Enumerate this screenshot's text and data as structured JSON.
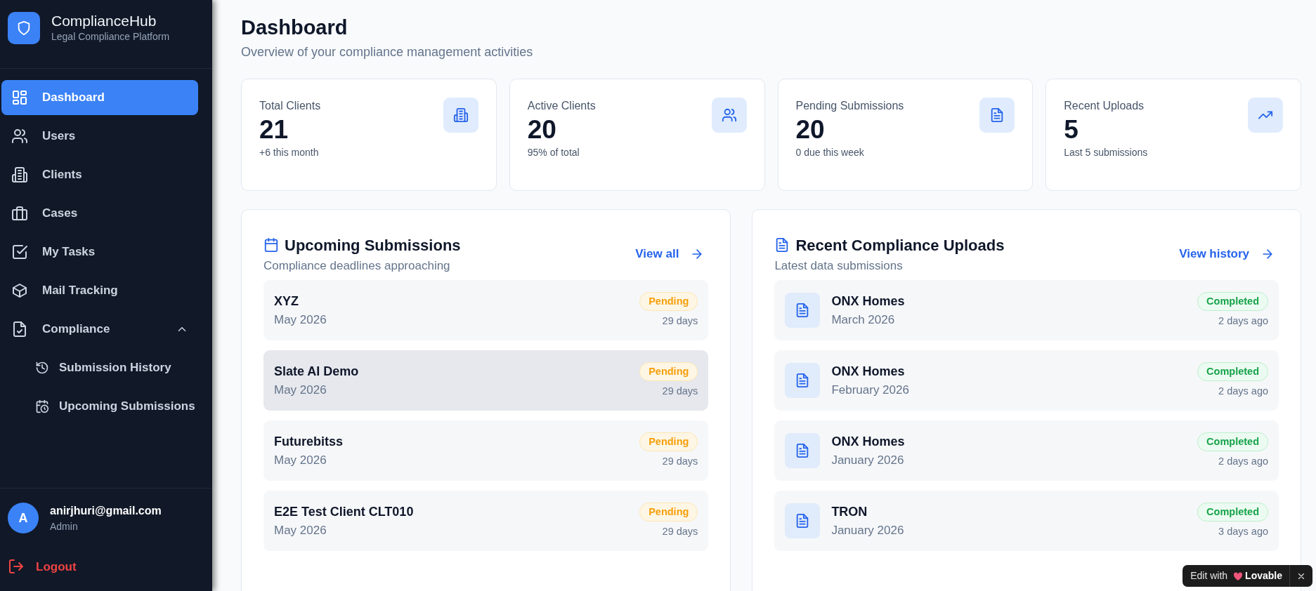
{
  "sidebar": {
    "brand": {
      "title": "ComplianceHub",
      "subtitle": "Legal Compliance Platform"
    },
    "nav": [
      {
        "label": "Dashboard",
        "selected": true
      },
      {
        "label": "Users",
        "selected": false
      },
      {
        "label": "Clients",
        "selected": false
      },
      {
        "label": "Cases",
        "selected": false
      },
      {
        "label": "My Tasks",
        "selected": false
      },
      {
        "label": "Mail Tracking",
        "selected": false
      },
      {
        "label": "Compliance",
        "selected": false,
        "expanded": true,
        "children": [
          {
            "label": "Submission History",
            "selected": false
          },
          {
            "label": "Upcoming Submissions",
            "selected": false
          }
        ]
      }
    ],
    "user": {
      "avatar": "A",
      "email": "anirjhuri@gmail.com",
      "role": "Admin"
    },
    "logout": "Logout"
  },
  "header": {
    "title": "Dashboard",
    "subtitle": "Overview of your compliance management activities"
  },
  "stats": [
    {
      "label": "Total Clients",
      "value": "21",
      "note": "+6 this month"
    },
    {
      "label": "Active Clients",
      "value": "20",
      "note": "95% of total"
    },
    {
      "label": "Pending Submissions",
      "value": "20",
      "note": "0 due this week"
    },
    {
      "label": "Recent Uploads",
      "value": "5",
      "note": "Last 5 submissions"
    }
  ],
  "panels": [
    {
      "kind": "upcoming",
      "title": "Upcoming Submissions",
      "subtitle": "Compliance deadlines approaching",
      "link": "View all",
      "items": [
        {
          "name": "XYZ",
          "period": "May 2026",
          "status": "Pending",
          "when": "29 days",
          "highlighted": false
        },
        {
          "name": "Slate AI Demo",
          "period": "May 2026",
          "status": "Pending",
          "when": "29 days",
          "highlighted": true
        },
        {
          "name": "Futurebitss",
          "period": "May 2026",
          "status": "Pending",
          "when": "29 days",
          "highlighted": false
        },
        {
          "name": "E2E Test Client CLT010",
          "period": "May 2026",
          "status": "Pending",
          "when": "29 days",
          "highlighted": false
        }
      ]
    },
    {
      "kind": "uploads",
      "title": "Recent Compliance Uploads",
      "subtitle": "Latest data submissions",
      "link": "View history",
      "items": [
        {
          "name": "ONX Homes",
          "period": "March 2026",
          "status": "Completed",
          "when": "2 days ago",
          "highlighted": false
        },
        {
          "name": "ONX Homes",
          "period": "February 2026",
          "status": "Completed",
          "when": "2 days ago",
          "highlighted": false
        },
        {
          "name": "ONX Homes",
          "period": "January 2026",
          "status": "Completed",
          "when": "2 days ago",
          "highlighted": false
        },
        {
          "name": "TRON",
          "period": "January 2026",
          "status": "Completed",
          "when": "3 days ago",
          "highlighted": false
        }
      ]
    }
  ],
  "edit_badge": {
    "text": "Edit with",
    "brand": "Lovable"
  }
}
